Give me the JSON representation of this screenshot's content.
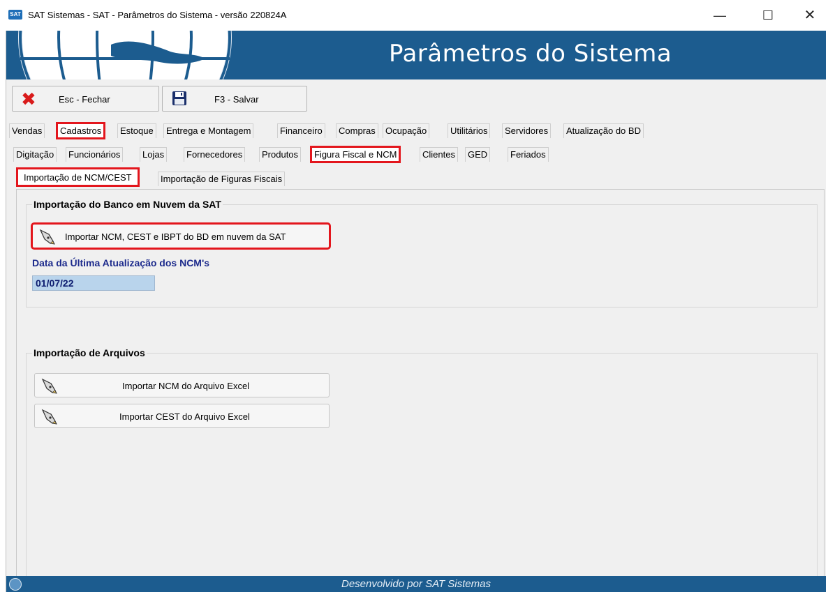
{
  "window": {
    "title": "SAT Sistemas - SAT - Parâmetros do Sistema - versão 220824A",
    "minimize": "—",
    "maximize": "☐",
    "close": "✕",
    "icon_text": "SAT"
  },
  "banner": {
    "title": "Parâmetros do Sistema"
  },
  "toolbar": {
    "close_label": "Esc - Fechar",
    "save_label": "F3 - Salvar"
  },
  "tabs_main": [
    "Vendas",
    "Cadastros",
    "Estoque",
    "Entrega e Montagem",
    "Financeiro",
    "Compras",
    "Ocupação",
    "Utilitários",
    "Servidores",
    "Atualização do BD"
  ],
  "tabs_cadastros": [
    "Digitação",
    "Funcionários",
    "Lojas",
    "Fornecedores",
    "Produtos",
    "Figura Fiscal e NCM",
    "Clientes",
    "GED",
    "Feriados"
  ],
  "tabs_figura": [
    "Importação de NCM/CEST",
    "Importação de Figuras Fiscais"
  ],
  "group_cloud": {
    "title": "Importação do Banco em Nuvem da SAT",
    "import_button": "Importar NCM, CEST e IBPT do BD em nuvem da SAT",
    "date_label": "Data da Última Atualização dos NCM's",
    "date_value": "01/07/22"
  },
  "group_files": {
    "title": "Importação de Arquivos",
    "ncm_button": "Importar NCM do Arquivo Excel",
    "cest_button": "Importar CEST do Arquivo Excel"
  },
  "status": {
    "text": "Desenvolvido por SAT Sistemas"
  },
  "colors": {
    "brand": "#1c5c8f",
    "highlight": "#e3161d",
    "date_label": "#1c2a8c"
  }
}
